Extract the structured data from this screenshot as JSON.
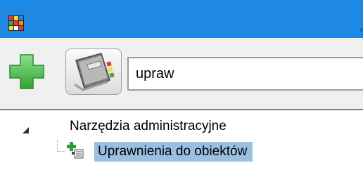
{
  "window": {
    "icon": "rubik-cube-icon"
  },
  "toolbar": {
    "add_button_icon": "green-plus-icon",
    "objects_button_icon": "address-book-icon"
  },
  "search": {
    "value": "upraw"
  },
  "tree": {
    "root": {
      "label": "Narzędzia administracyjne",
      "expanded": true
    },
    "children": [
      {
        "label": "Uprawnienia do obiektów",
        "selected": true,
        "icon": "permissions-icon"
      }
    ]
  },
  "colors": {
    "titlebar": "#1e88e5",
    "selection": "#9bbfe3",
    "add_icon": "#4cc24c"
  }
}
